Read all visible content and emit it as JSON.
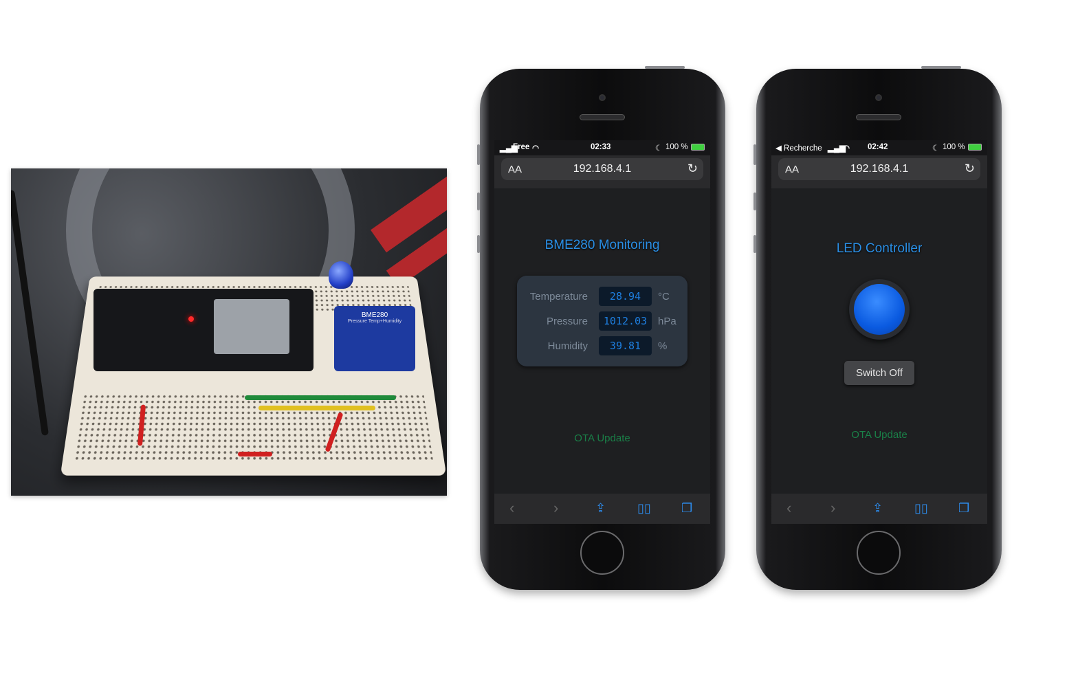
{
  "photo": {
    "bme_label": "BME280",
    "bme_sub": "Pressure Temp+Humidity"
  },
  "phones": [
    {
      "status": {
        "carrier": "Free",
        "time": "02:33",
        "battery": "100 %"
      },
      "url": "192.168.4.1",
      "text_size": "AA",
      "page": {
        "title": "BME280 Monitoring",
        "readings": [
          {
            "label": "Temperature",
            "value": "28.94",
            "unit": "°C"
          },
          {
            "label": "Pressure",
            "value": "1012.03",
            "unit": "hPa"
          },
          {
            "label": "Humidity",
            "value": "39.81",
            "unit": "%"
          }
        ],
        "ota_link": "OTA Update"
      }
    },
    {
      "status": {
        "back": "◀ Recherche",
        "time": "02:42",
        "battery": "100 %"
      },
      "url": "192.168.4.1",
      "text_size": "AA",
      "page": {
        "title": "LED Controller",
        "led_state": "on",
        "led_color": "#0a5ae0",
        "switch_label": "Switch Off",
        "ota_link": "OTA Update"
      }
    }
  ],
  "toolbar_icons": [
    "back-icon",
    "forward-icon",
    "share-icon",
    "bookmarks-icon",
    "tabs-icon"
  ],
  "colors": {
    "title": "#2a8fe6",
    "ota": "#1a8048",
    "lcd_text": "#1e7fe0"
  }
}
